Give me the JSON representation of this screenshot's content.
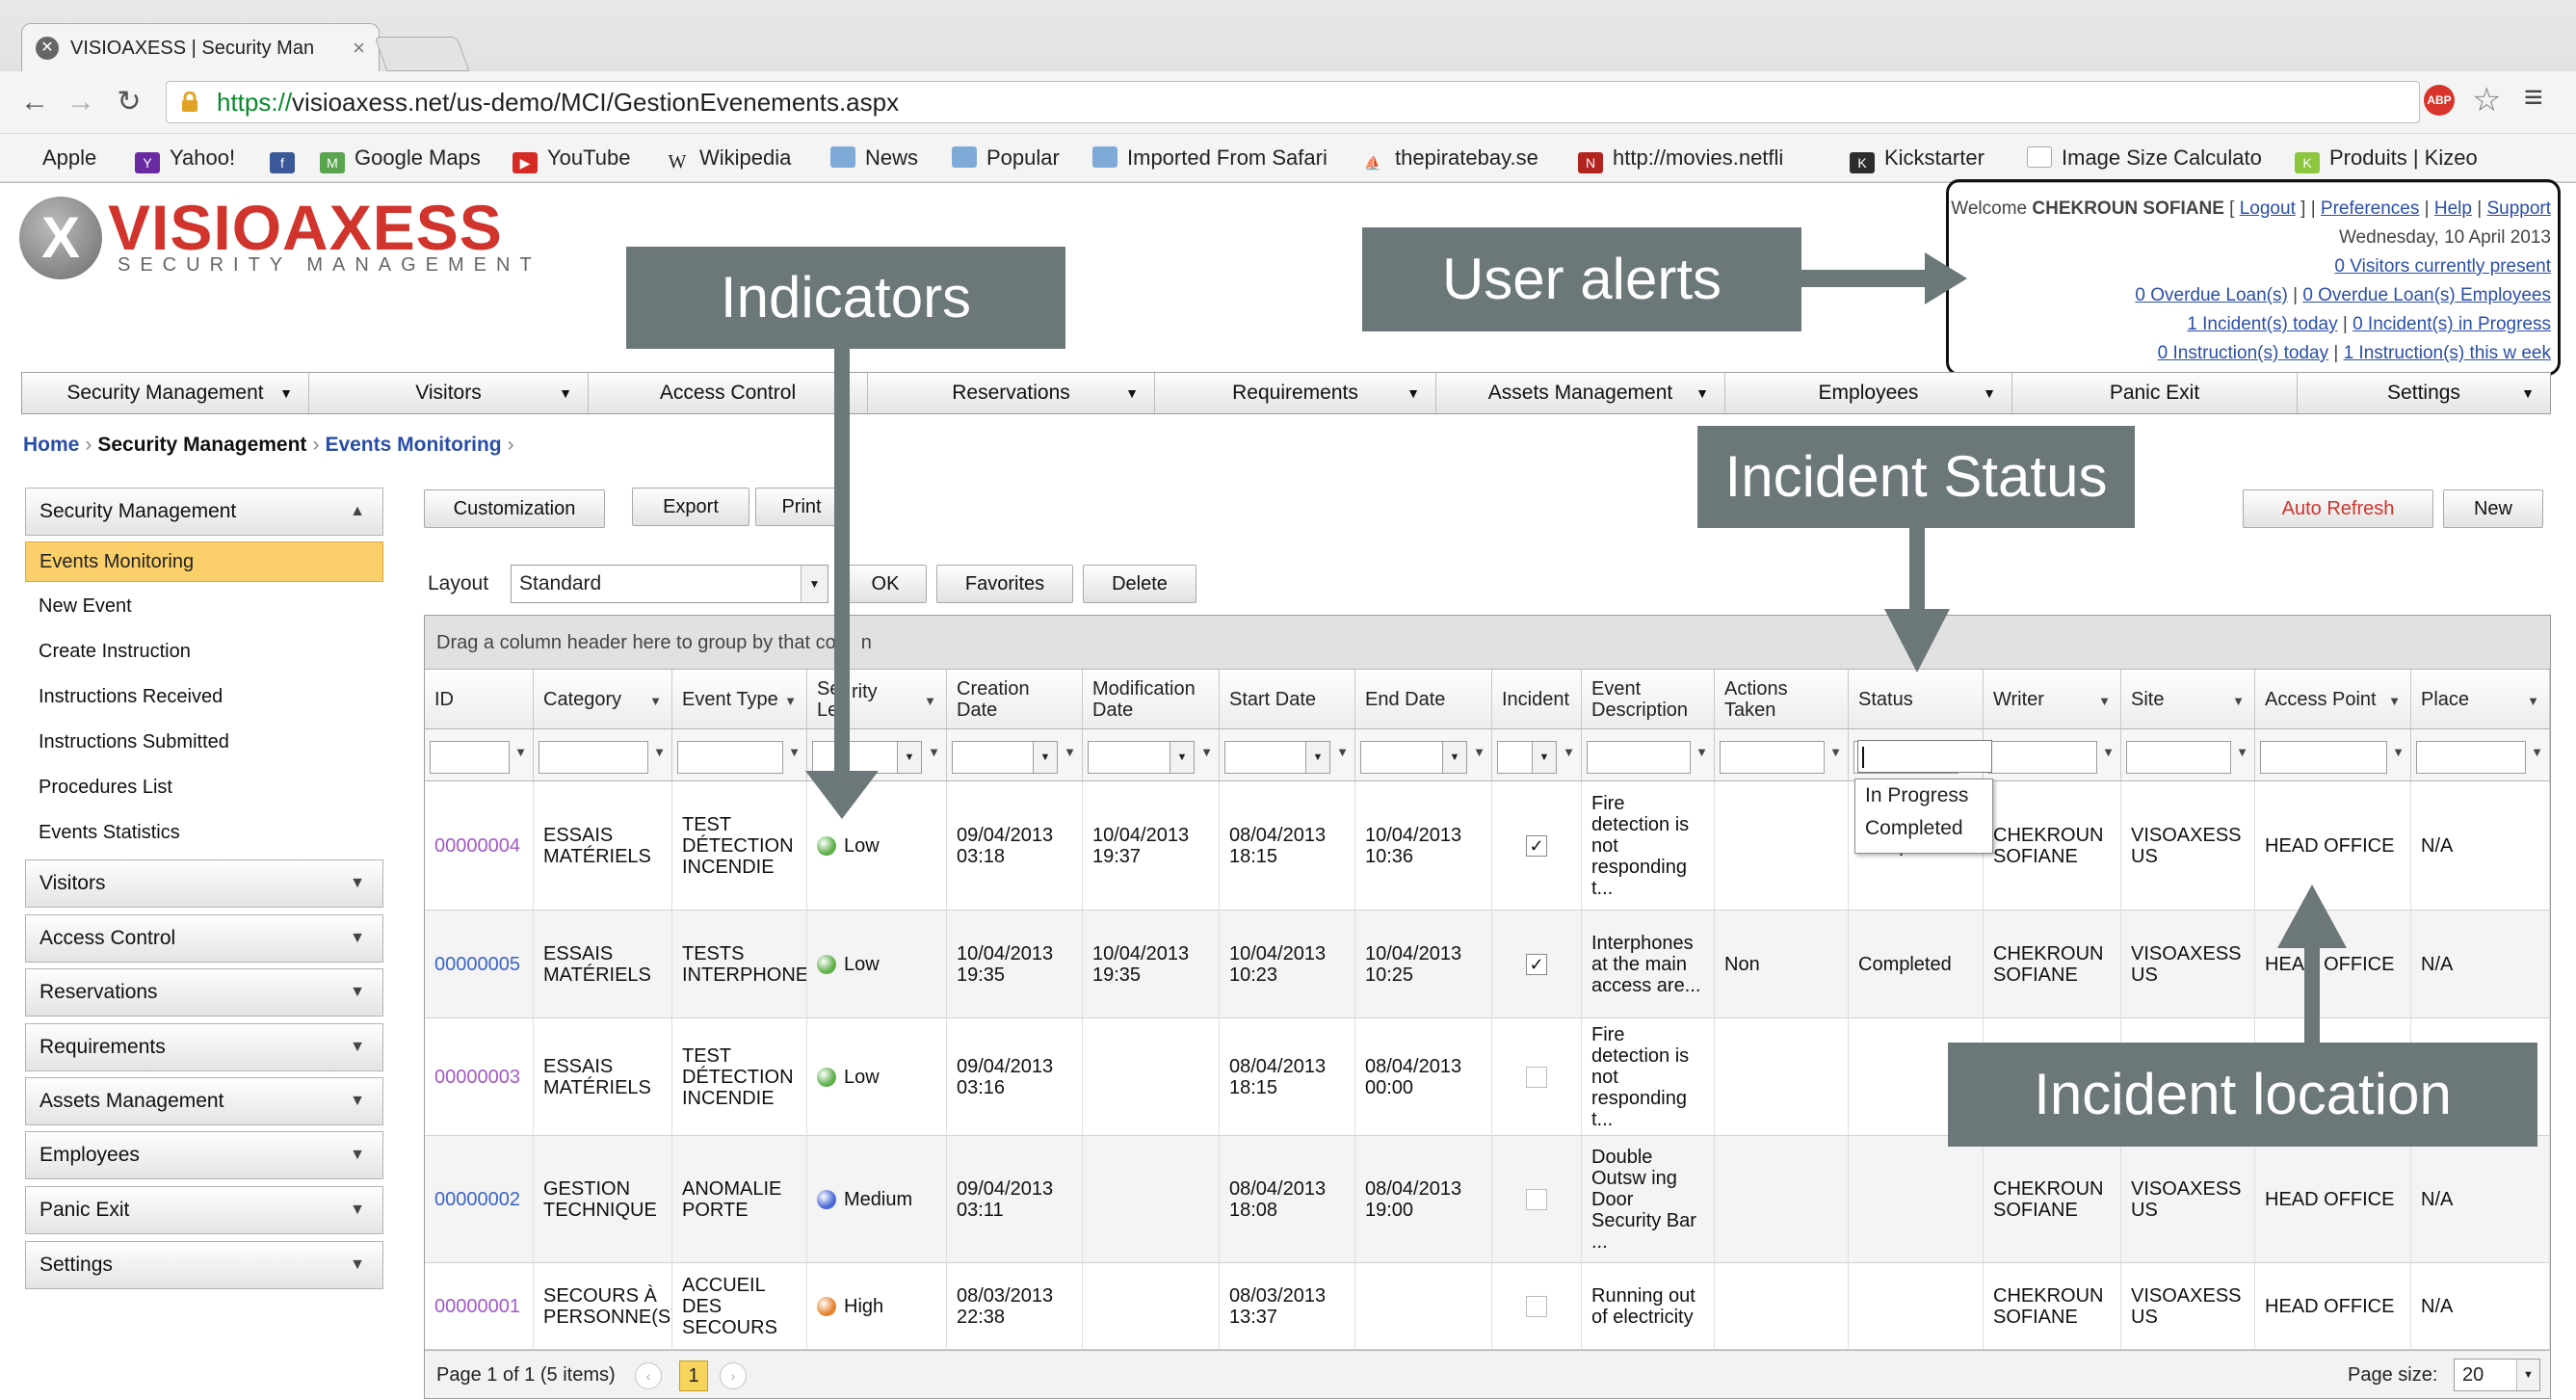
{
  "browser": {
    "tab_title": "VISIOAXESS | Security Man",
    "url_scheme": "https://",
    "url_rest": "visioaxess.net/us-demo/MCI/GestionEvenements.aspx",
    "adblock": "ABP",
    "bookmarks": [
      "Apple",
      "Yahoo!",
      "Google Maps",
      "YouTube",
      "Wikipedia",
      "News",
      "Popular",
      "Imported From Safari",
      "thepiratebay.se",
      "http://movies.netfli",
      "Kickstarter",
      "Image Size Calculato",
      "Produits | Kizeo"
    ]
  },
  "logo": {
    "name": "VISIOAXESS",
    "tagline": "SECURITY MANAGEMENT"
  },
  "user_alerts": {
    "welcome_prefix": "Welcome",
    "user": "CHEKROUN SOFIANE",
    "logout": "Logout",
    "preferences": "Preferences",
    "help": "Help",
    "support": "Support",
    "date": "Wednesday, 10 April 2013",
    "visitors": "0 Visitors currently present",
    "overdue_loans": "0 Overdue Loan(s)",
    "overdue_loans_emp": "0 Overdue Loan(s) Employees",
    "incidents_today": "1 Incident(s) today",
    "incidents_progress": "0 Incident(s) in Progress",
    "instructions_today": "0 Instruction(s) today",
    "instructions_week": "1 Instruction(s) this w eek"
  },
  "mainnav": [
    "Security Management",
    "Visitors",
    "Access Control",
    "Reservations",
    "Requirements",
    "Assets Management",
    "Employees",
    "Panic Exit",
    "Settings"
  ],
  "breadcrumb": {
    "home": "Home",
    "section": "Security Management",
    "page": "Events Monitoring"
  },
  "sidebar": {
    "open_header": "Security Management",
    "active": "Events Monitoring",
    "items": [
      "New Event",
      "Create Instruction",
      "Instructions Received",
      "Instructions Submitted",
      "Procedures List",
      "Events Statistics"
    ],
    "collapsed": [
      "Visitors",
      "Access Control",
      "Reservations",
      "Requirements",
      "Assets Management",
      "Employees",
      "Panic Exit",
      "Settings"
    ]
  },
  "toolbar": {
    "customization": "Customization",
    "export": "Export",
    "print": "Print",
    "auto_refresh": "Auto Refresh",
    "new": "New",
    "layout_label": "Layout",
    "layout_value": "Standard",
    "ok": "OK",
    "favorites": "Favorites",
    "delete": "Delete"
  },
  "grid": {
    "group_hint": "Drag a column header here to group by that co",
    "group_hint_end": "n",
    "headers": [
      "ID",
      "Category",
      "Event Type",
      "Se\nLe",
      "Creation Date",
      "Modification Date",
      "Start Date",
      "End Date",
      "Incident",
      "Event Description",
      "Actions Taken",
      "Status",
      "Writer",
      "Site",
      "Access Point",
      "Place"
    ],
    "header_security_right": "rity",
    "rows": [
      {
        "id": "00000004",
        "category": "ESSAIS MATÉRIELS",
        "event_type": "TEST DÉTECTION INCENDIE",
        "level": "Low",
        "level_color": "#5fb04a",
        "created": "09/04/2013 03:18",
        "modified": "10/04/2013 19:37",
        "start": "08/04/2013 18:15",
        "end": "10/04/2013 10:36",
        "incident": true,
        "description": "Fire detection is not responding t...",
        "actions": "",
        "status": "Completed",
        "writer": "CHEKROUN SOFIANE",
        "site": "VISOAXESS US",
        "access_point": "HEAD OFFICE",
        "place": "N/A"
      },
      {
        "id": "00000005",
        "category": "ESSAIS MATÉRIELS",
        "event_type": "TESTS INTERPHONES",
        "level": "Low",
        "level_color": "#5fb04a",
        "created": "10/04/2013 19:35",
        "modified": "10/04/2013 19:35",
        "start": "10/04/2013 10:23",
        "end": "10/04/2013 10:25",
        "incident": true,
        "description": "Interphones at the main access are...",
        "actions": "Non",
        "status": "Completed",
        "writer": "CHEKROUN SOFIANE",
        "site": "VISOAXESS US",
        "access_point": "HEAD OFFICE",
        "place": "N/A"
      },
      {
        "id": "00000003",
        "category": "ESSAIS MATÉRIELS",
        "event_type": "TEST DÉTECTION INCENDIE",
        "level": "Low",
        "level_color": "#5fb04a",
        "created": "09/04/2013 03:16",
        "modified": "",
        "start": "08/04/2013 18:15",
        "end": "08/04/2013 00:00",
        "incident": false,
        "description": "Fire detection is not responding t...",
        "actions": "",
        "status": "",
        "writer": "",
        "site": "",
        "access_point": "",
        "place": ""
      },
      {
        "id": "00000002",
        "category": "GESTION TECHNIQUE",
        "event_type": "ANOMALIE PORTE",
        "level": "Medium",
        "level_color": "#4a68d8",
        "created": "09/04/2013 03:11",
        "modified": "",
        "start": "08/04/2013 18:08",
        "end": "08/04/2013 19:00",
        "incident": false,
        "description": "Double Outsw ing Door Security Bar ...",
        "actions": "",
        "status": "",
        "writer": "CHEKROUN SOFIANE",
        "site": "VISOAXESS US",
        "access_point": "HEAD OFFICE",
        "place": "N/A"
      },
      {
        "id": "00000001",
        "category": "SECOURS À PERSONNE(S)",
        "event_type": "ACCUEIL DES SECOURS",
        "level": "High",
        "level_color": "#e8822c",
        "created": "08/03/2013 22:38",
        "modified": "",
        "start": "08/03/2013 13:37",
        "end": "",
        "incident": false,
        "description": "Running out of electricity",
        "actions": "",
        "status": "",
        "writer": "CHEKROUN SOFIANE",
        "site": "VISOAXESS US",
        "access_point": "HEAD OFFICE",
        "place": "N/A"
      }
    ],
    "status_options": [
      "In Progress",
      "Completed"
    ],
    "pager_text": "Page 1 of 1 (5 items)",
    "current_page": "1",
    "page_size_label": "Page size:",
    "page_size": "20"
  },
  "annotations": {
    "indicators": "Indicators",
    "user_alerts": "User alerts",
    "incident_status": "Incident Status",
    "incident_location": "Incident location",
    "color": "#6b7778"
  }
}
